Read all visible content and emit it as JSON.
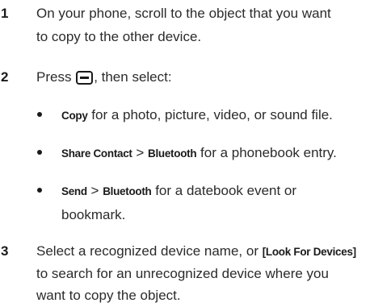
{
  "steps": [
    {
      "number": "1",
      "lines": [
        "On your phone, scroll to the object that you want",
        "to copy to the other device."
      ]
    },
    {
      "number": "2",
      "before_icon": "Press ",
      "icon": "menu-key-icon",
      "after_icon": ", then select:"
    },
    {
      "number": "3",
      "line1_em": "Select a recognized device name, or ",
      "line1_key": "[Look For Devices]",
      "lines_rest": [
        "to search for an unrecognized device where you",
        "want to copy the object."
      ]
    }
  ],
  "bullets": [
    {
      "parts": [
        {
          "text": "Copy",
          "style": "key"
        },
        {
          "text": " for a photo, picture, video, or sound file.",
          "style": "normal"
        }
      ]
    },
    {
      "parts": [
        {
          "text": "Share Contact",
          "style": "key"
        },
        {
          "text": " > ",
          "style": "normal"
        },
        {
          "text": "Bluetooth",
          "style": "key"
        },
        {
          "text": " for a phonebook entry.",
          "style": "normal"
        }
      ]
    },
    {
      "parts": [
        {
          "text": "Send",
          "style": "key"
        },
        {
          "text": " > ",
          "style": "normal"
        },
        {
          "text": "Bluetooth",
          "style": "key"
        },
        {
          "text": " for a datebook event or",
          "style": "normal"
        }
      ],
      "continuation": "bookmark."
    }
  ]
}
